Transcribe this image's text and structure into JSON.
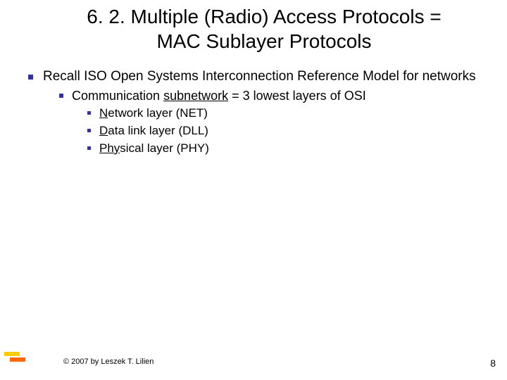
{
  "title": {
    "line1": "6. 2. Multiple (Radio) Access Protocols =",
    "line2": "MAC Sublayer Protocols"
  },
  "bullets": {
    "l1": "Recall ISO Open Systems Interconnection Reference Model for networks",
    "l2_pre": "Communication ",
    "l2_u": "subnetwork",
    "l2_post": " = 3 lowest layers of OSI",
    "l3a_u": "N",
    "l3a_rest": "etwork layer (NET)",
    "l3b_u": "D",
    "l3b_rest": "ata link layer (DLL)",
    "l3c_u": "Phy",
    "l3c_rest": "sical layer (PHY)"
  },
  "footer": {
    "copyright": "© 2007 by Leszek T. Lilien",
    "page": "8"
  }
}
